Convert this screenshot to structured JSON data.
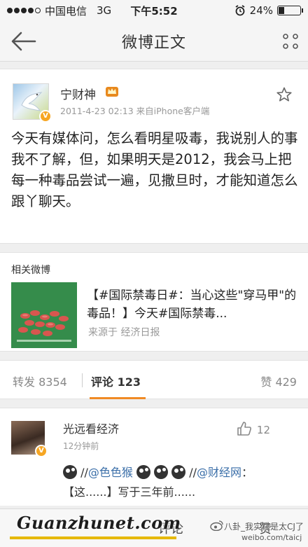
{
  "status_bar": {
    "carrier": "中国电信",
    "network": "3G",
    "time": "下午5:52",
    "battery_percent": "24%",
    "battery_level": 0.24
  },
  "nav": {
    "title": "微博正文"
  },
  "post": {
    "author": "宁财神",
    "verified_badge": "V",
    "timestamp_source": "2011-4-23 02:13  来自iPhone客户端",
    "text": "今天有媒体问，怎么看明星吸毒，我说别人的事我不了解，但，如果明天是2012，我会马上把每一种毒品尝试一遍，见撒旦时，才能知道怎么跟丫聊天。"
  },
  "related": {
    "heading": "相关微博",
    "title": "【#国际禁毒日#：当心这些\"穿马甲\"的毒品！】今天#国际禁毒...",
    "source": "来源于  经济日报"
  },
  "tabs": {
    "repost": "转发 8354",
    "comment": "评论 123",
    "like": "赞 429"
  },
  "comment": {
    "user": "光远看经济",
    "time": "12分钟前",
    "like_count": "12",
    "mention1": "@色色猴",
    "sep1": "//",
    "sep2": "//",
    "mention2": "@财经网",
    "body": "：【这......】写于三年前......"
  },
  "bottom_bar": {
    "comment": "评论",
    "like": "赞"
  },
  "watermark": {
    "site": "Guanzhunet.com",
    "handle": "八卦_我实在是太CJ了",
    "url": "weibo.com/taicj"
  },
  "colors": {
    "accent": "#f08a24",
    "link": "#3a6ea8",
    "verified": "#f6a623"
  }
}
